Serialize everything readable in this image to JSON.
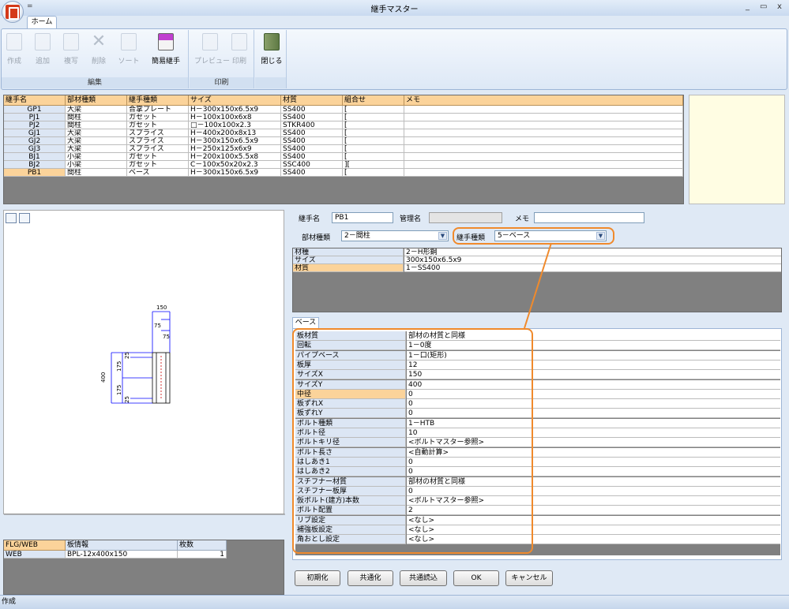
{
  "window": {
    "title": "継手マスター",
    "min": "_",
    "restore": "▭",
    "close": "x",
    "qat": "="
  },
  "tabs": [
    {
      "label": "ホーム"
    }
  ],
  "ribbon": {
    "groups": [
      {
        "label": "編集",
        "buttons": [
          {
            "label": "作成",
            "enabled": false
          },
          {
            "label": "追加",
            "enabled": false
          },
          {
            "label": "複写",
            "enabled": false
          },
          {
            "label": "削除",
            "enabled": false
          },
          {
            "label": "ソート",
            "enabled": false
          },
          {
            "label": "簡易継手",
            "enabled": true
          }
        ]
      },
      {
        "label": "印刷",
        "buttons": [
          {
            "label": "プレビュー",
            "enabled": false
          },
          {
            "label": "印刷",
            "enabled": false
          }
        ]
      },
      {
        "label": "",
        "buttons": [
          {
            "label": "閉じる",
            "enabled": true
          }
        ]
      }
    ]
  },
  "joint_table": {
    "columns": [
      "継手名",
      "部材種類",
      "継手種類",
      "サイズ",
      "材質",
      "組合せ",
      "メモ"
    ],
    "rows": [
      [
        "GP1",
        "大梁",
        "合掌プレート",
        "H－300x150x6.5x9",
        "SS400",
        "[",
        ""
      ],
      [
        "PJ1",
        "間柱",
        "ガセット",
        "H－100x100x6x8",
        "SS400",
        "[",
        ""
      ],
      [
        "PJ2",
        "間柱",
        "ガセット",
        "□－100x100x2.3",
        "STKR400",
        "[",
        ""
      ],
      [
        "GJ1",
        "大梁",
        "スプライス",
        "H－400x200x8x13",
        "SS400",
        "[",
        ""
      ],
      [
        "GJ2",
        "大梁",
        "スプライス",
        "H－300x150x6.5x9",
        "SS400",
        "[",
        ""
      ],
      [
        "GJ3",
        "大梁",
        "スプライス",
        "H－250x125x6x9",
        "SS400",
        "[",
        ""
      ],
      [
        "BJ1",
        "小梁",
        "ガセット",
        "H－200x100x5.5x8",
        "SS400",
        "[",
        ""
      ],
      [
        "BJ2",
        "小梁",
        "ガセット",
        "C－100x50x20x2.3",
        "SSC400",
        "][",
        ""
      ],
      [
        "PB1",
        "間柱",
        "ベース",
        "H－300x150x6.5x9",
        "SS400",
        "[",
        ""
      ]
    ],
    "selected_row": 8
  },
  "drawing": {
    "dims": {
      "top": "150",
      "t1": "75",
      "t2": "75",
      "left": "400",
      "l1": "175",
      "l2": "175",
      "s1": "25",
      "s2": "25"
    }
  },
  "plate_table": {
    "columns": [
      "FLG/WEB",
      "板情報",
      "枚数"
    ],
    "rows": [
      [
        "WEB",
        "BPL-12x400x150",
        "1"
      ]
    ]
  },
  "form": {
    "joint_name_label": "継手名",
    "joint_name_value": "PB1",
    "manage_name_label": "管理名",
    "manage_name_value": "",
    "memo_label": "メモ",
    "memo_value": "",
    "member_type_label": "部材種類",
    "member_type_value": "2－間柱",
    "joint_type_label": "継手種類",
    "joint_type_value": "5－ベース"
  },
  "member_props": [
    [
      "材種",
      "2－H形鋼"
    ],
    [
      "サイズ",
      "300x150x6.5x9"
    ],
    [
      "材質",
      "1－SS400"
    ]
  ],
  "base_tab": {
    "label": "ベース"
  },
  "base_props": [
    [
      "板材質",
      "部材の材質と同様"
    ],
    [
      "回転",
      "1－0度"
    ],
    [
      "パイプベース",
      "1－口(矩形)"
    ],
    [
      "板厚",
      "12"
    ],
    [
      "サイズX",
      "150"
    ],
    [
      "サイズY",
      "400"
    ],
    [
      "中径",
      "0"
    ],
    [
      "板ずれX",
      "0"
    ],
    [
      "板ずれY",
      "0"
    ],
    [
      "ボルト種類",
      "1－HTB"
    ],
    [
      "ボルト径",
      "10"
    ],
    [
      "ボルトキリ径",
      "<ボルトマスター参照>"
    ],
    [
      "ボルト長さ",
      "<自動計算>"
    ],
    [
      "はしあき1",
      "0"
    ],
    [
      "はしあき2",
      "0"
    ],
    [
      "スチフナー材質",
      "部材の材質と同様"
    ],
    [
      "スチフナー板厚",
      "0"
    ],
    [
      "仮ボルト(建方)本数",
      "<ボルトマスター参照>"
    ],
    [
      "ボルト配置",
      "2"
    ],
    [
      "リブ設定",
      "<なし>"
    ],
    [
      "補強板設定",
      "<なし>"
    ],
    [
      "角おとし設定",
      "<なし>"
    ]
  ],
  "base_selected": 6,
  "buttons": {
    "init": "初期化",
    "common": "共通化",
    "common_read": "共通読込",
    "ok": "OK",
    "cancel": "キャンセル"
  },
  "status": {
    "text": "作成"
  },
  "colors": {
    "accent": "#fbd39a",
    "highlight": "#f08a2c",
    "header_blue": "#dce6f4"
  }
}
